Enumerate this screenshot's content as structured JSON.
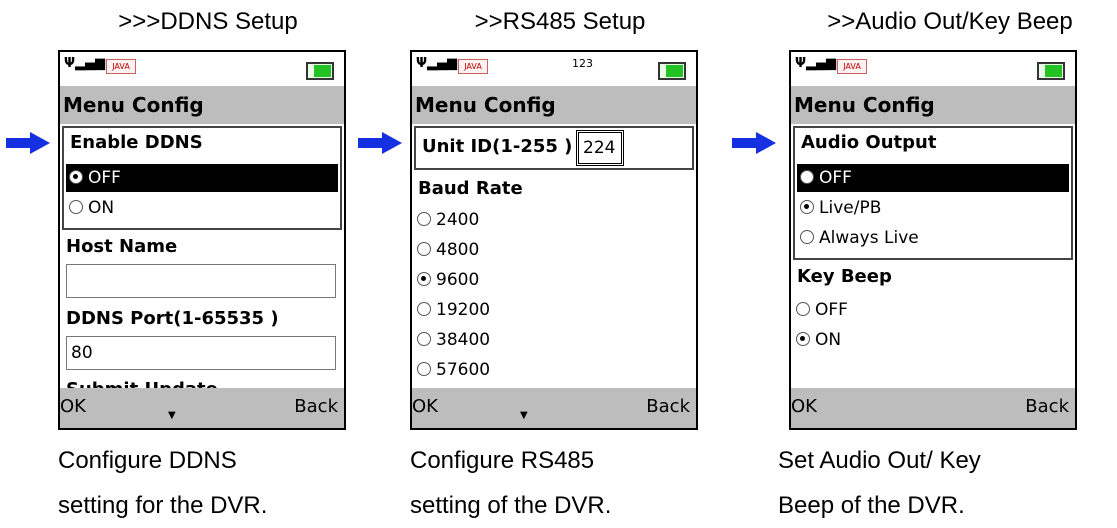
{
  "panels": [
    {
      "title": ">>>DDNS Setup",
      "caption_line1": "Configure DDNS",
      "caption_line2": "setting for the DVR.",
      "screen": {
        "menu_header": "Menu Config",
        "enable_label": "Enable DDNS",
        "options": [
          "OFF",
          "ON"
        ],
        "host_label": "Host Name",
        "host_value": "",
        "port_label": "DDNS Port(1-65535 )",
        "port_value": "80",
        "cut_label": "Submit Update",
        "softkey_ok": "OK",
        "softkey_back": "Back"
      }
    },
    {
      "title": ">>RS485 Setup",
      "caption_line1": "Configure RS485",
      "caption_line2": "setting of the DVR.",
      "screen": {
        "status_number": "123",
        "menu_header": "Menu Config",
        "unit_label": "Unit ID(1-255 )",
        "unit_value": "224",
        "baud_label": "Baud Rate",
        "baud_options": [
          "2400",
          "4800",
          "9600",
          "19200",
          "38400",
          "57600"
        ],
        "softkey_ok": "OK",
        "softkey_back": "Back"
      }
    },
    {
      "title": ">>Audio Out/Key Beep",
      "caption_line1": "Set Audio Out/ Key",
      "caption_line2": "Beep of the DVR.",
      "screen": {
        "menu_header": "Menu Config",
        "audio_label": "Audio Output",
        "audio_options": [
          "OFF",
          "Live/PB",
          "Always Live"
        ],
        "beep_label": "Key Beep",
        "beep_options": [
          "OFF",
          "ON"
        ],
        "softkey_ok": "OK",
        "softkey_back": "Back"
      }
    }
  ],
  "status": {
    "java_badge": "JAVA"
  },
  "colors": {
    "arrow": "#1530e0",
    "header": "#bdbdbd",
    "battery": "#22c322"
  }
}
